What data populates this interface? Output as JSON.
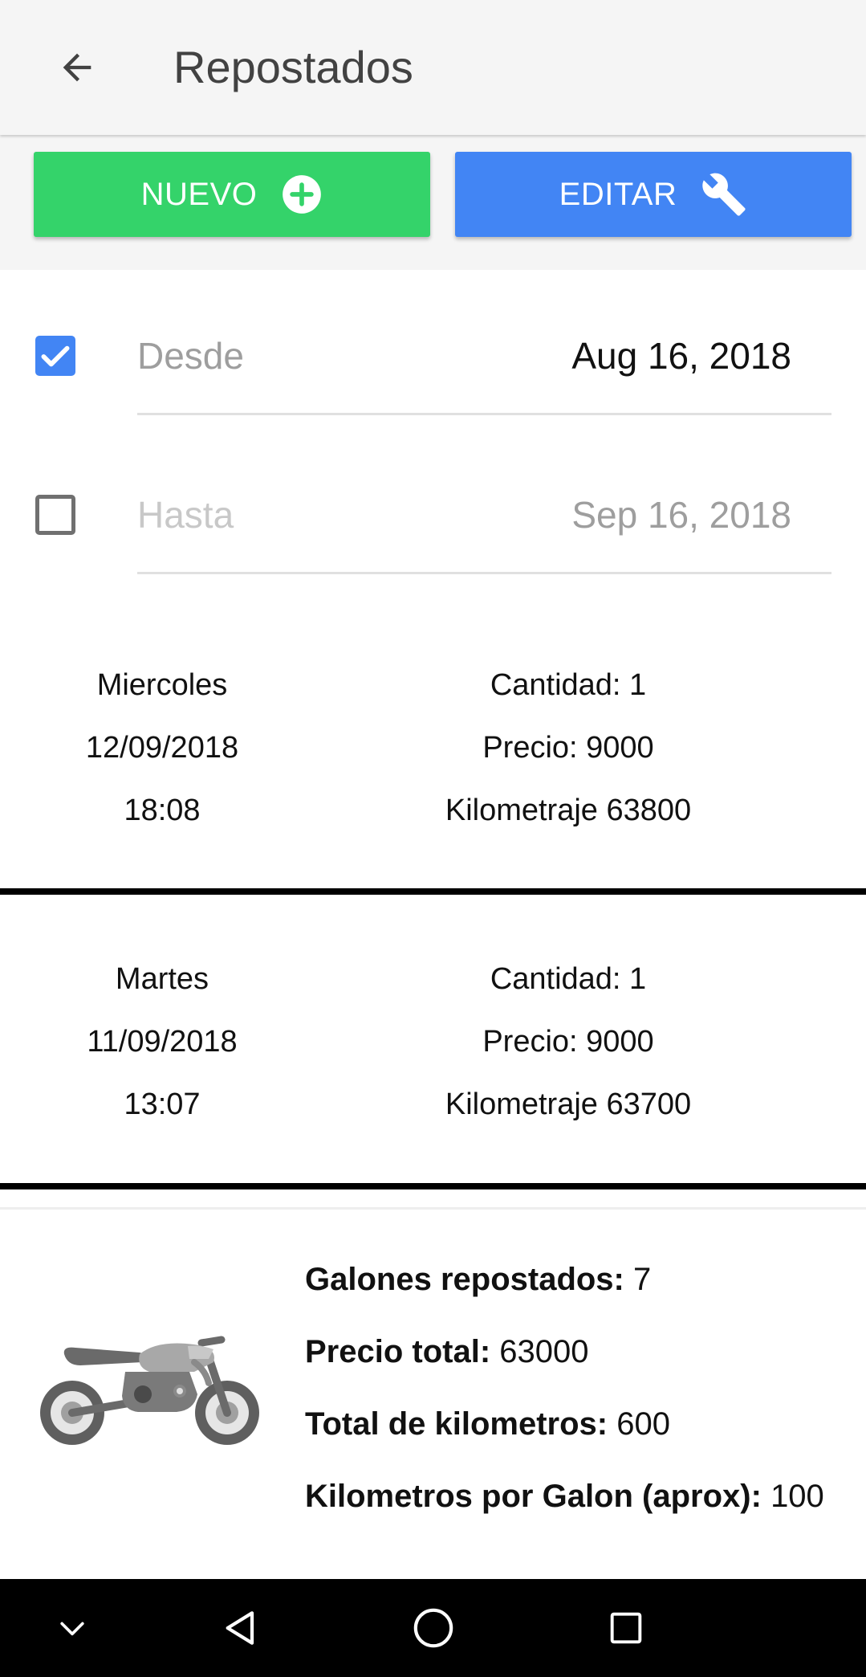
{
  "appbar": {
    "title": "Repostados",
    "back_icon": "arrow-left-icon"
  },
  "actions": {
    "new_label": "NUEVO",
    "new_icon": "plus-circle-icon",
    "edit_label": "EDITAR",
    "edit_icon": "wrench-icon",
    "new_color": "#34d36a",
    "edit_color": "#4285f4"
  },
  "filter": {
    "desde": {
      "checked": true,
      "label": "Desde",
      "date": "Aug 16, 2018"
    },
    "hasta": {
      "checked": false,
      "label": "Hasta",
      "date": "Sep 16, 2018"
    }
  },
  "records": [
    {
      "day": "Miercoles",
      "date": "12/09/2018",
      "time": "18:08",
      "cantidad": "Cantidad: 1",
      "precio": "Precio: 9000",
      "kilometraje": "Kilometraje 63800"
    },
    {
      "day": "Martes",
      "date": "11/09/2018",
      "time": "13:07",
      "cantidad": "Cantidad: 1",
      "precio": "Precio: 9000",
      "kilometraje": "Kilometraje 63700"
    }
  ],
  "summary": {
    "image_icon": "motorcycle-icon",
    "galones_label": "Galones repostados:",
    "galones_value": "7",
    "precio_label": "Precio total:",
    "precio_value": "63000",
    "km_label": "Total de kilometros:",
    "km_value": "600",
    "kmpg_label": "Kilometros por Galon (aprox):",
    "kmpg_value": "100"
  },
  "navbar": {
    "icons": [
      "chevron-down-icon",
      "back-triangle-icon",
      "home-circle-icon",
      "recents-square-icon"
    ]
  }
}
